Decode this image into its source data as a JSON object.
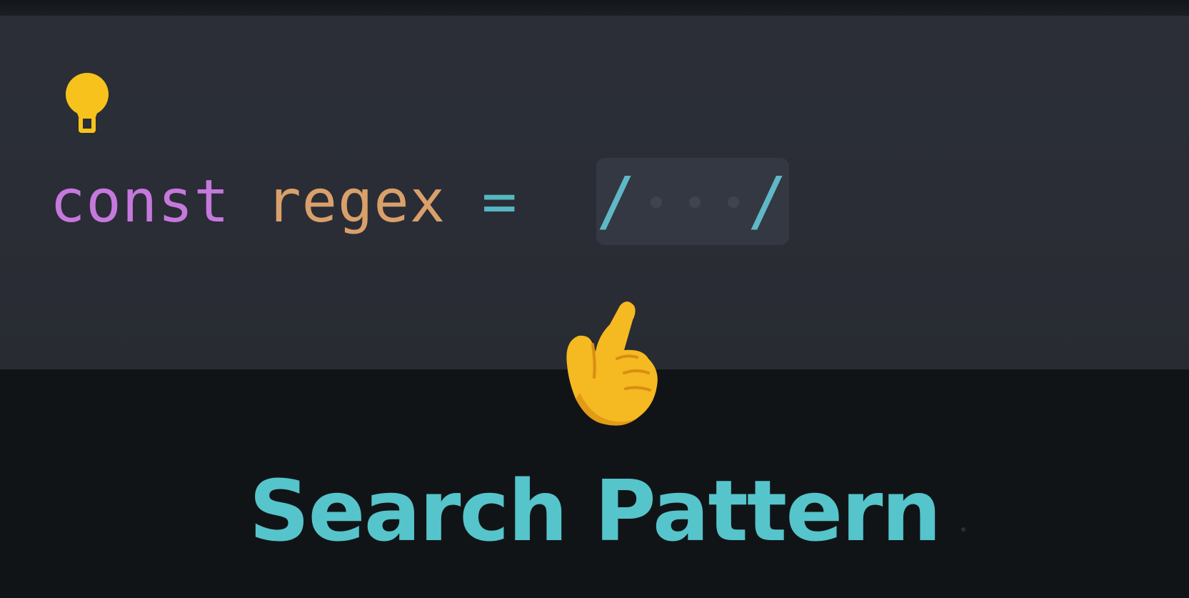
{
  "code": {
    "keyword": "const",
    "identifier": "regex",
    "operator": "=",
    "regex_open": "/",
    "regex_close": "/"
  },
  "caption": {
    "text": "Search Pattern"
  },
  "icons": {
    "hint": "lightbulb-icon",
    "pointer": "pointing-hand-icon"
  },
  "colors": {
    "keyword": "#c678dd",
    "identifier": "#d9a06b",
    "operator": "#56b6c2",
    "caption": "#56c4cb",
    "bulb": "#f7c21b",
    "editor_bg": "#2a2d35",
    "page_bg": "#111417"
  }
}
